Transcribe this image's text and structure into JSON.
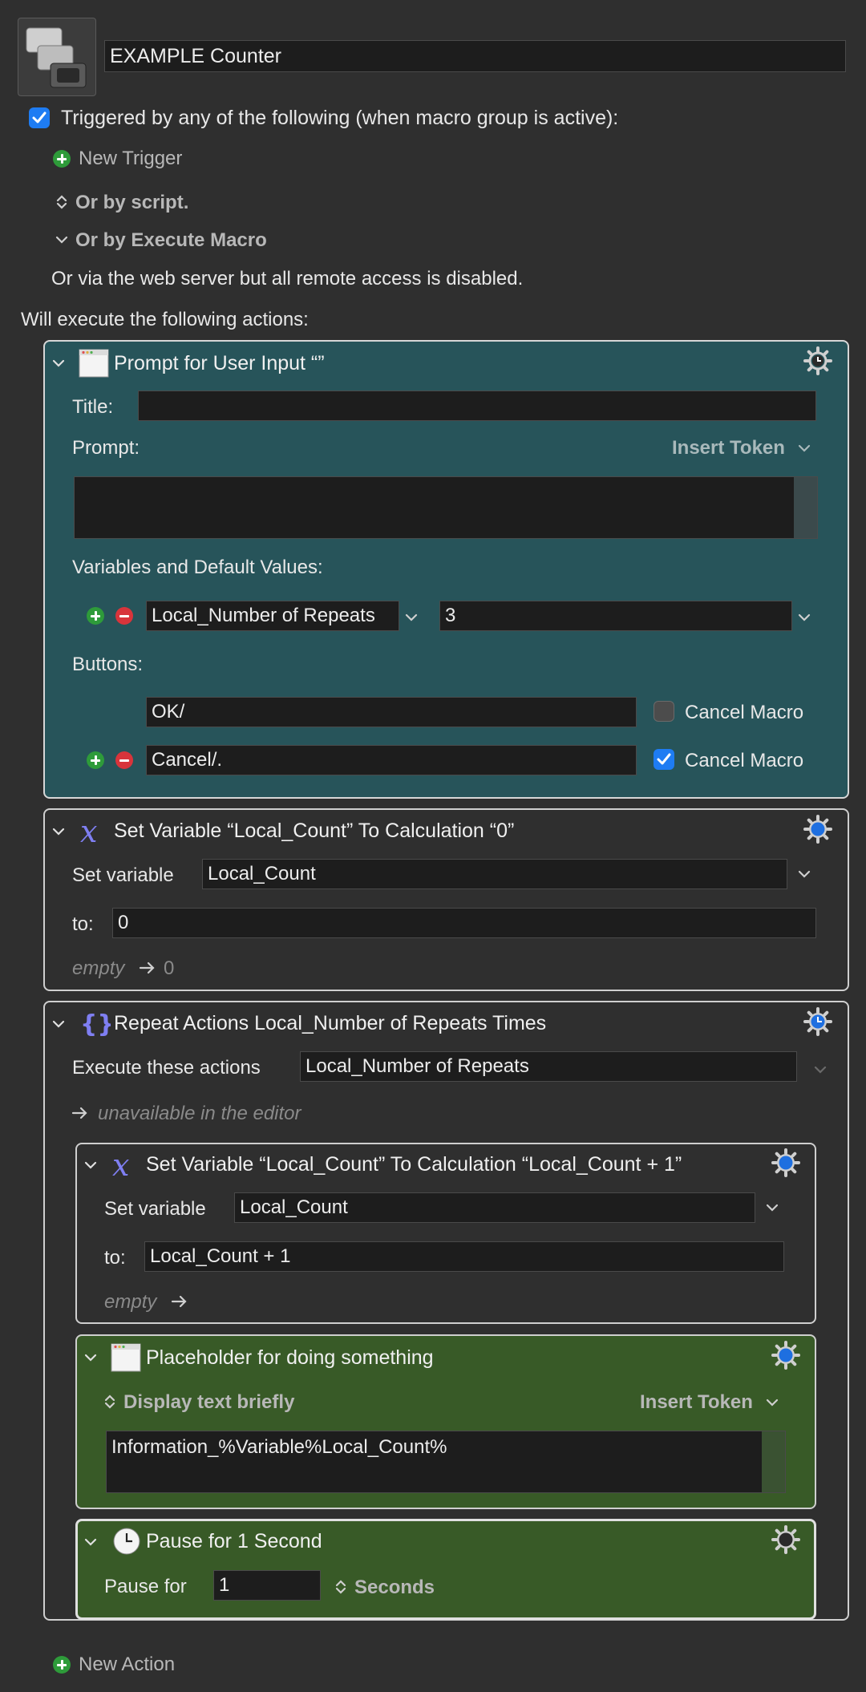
{
  "macro": {
    "name": "EXAMPLE Counter",
    "trigger_checkbox_label": "Triggered by any of the following (when macro group is active):",
    "new_trigger": "New Trigger",
    "or_by_script": "Or by script.",
    "or_by_execute": "Or by Execute Macro",
    "web_server_note": "Or via the web server but all remote access is disabled.",
    "will_execute": "Will execute the following actions:",
    "new_action": "New Action"
  },
  "prompt_action": {
    "title": "Prompt for User Input “”",
    "title_label": "Title:",
    "title_value": "",
    "prompt_label": "Prompt:",
    "insert_token": "Insert Token",
    "prompt_value": "",
    "variables_label": "Variables and Default Values:",
    "variable_name": "Local_Number of Repeats",
    "variable_default": "3",
    "buttons_label": "Buttons:",
    "buttons": [
      {
        "value": "OK/",
        "cancel_label": "Cancel Macro",
        "cancel_checked": false
      },
      {
        "value": "Cancel/.",
        "cancel_label": "Cancel Macro",
        "cancel_checked": true
      }
    ]
  },
  "set_var_action": {
    "title": "Set Variable “Local_Count” To Calculation “0”",
    "set_label": "Set variable",
    "variable": "Local_Count",
    "to_label": "to:",
    "to_value": "0",
    "empty_word": "empty",
    "result": "0"
  },
  "repeat_action": {
    "title": "Repeat Actions Local_Number of Repeats Times",
    "execute_label": "Execute these actions",
    "execute_value": "Local_Number of Repeats",
    "unavailable": "unavailable in the editor"
  },
  "inner_set_var": {
    "title": "Set Variable “Local_Count” To Calculation “Local_Count + 1”",
    "set_label": "Set variable",
    "variable": "Local_Count",
    "to_label": "to:",
    "to_value": "Local_Count + 1",
    "empty_word": "empty"
  },
  "display_action": {
    "title": "Placeholder for doing something",
    "mode": "Display text briefly",
    "insert_token": "Insert Token",
    "text": "Information_%Variable%Local_Count%"
  },
  "pause_action": {
    "title": "Pause for 1 Second",
    "pause_label": "Pause for",
    "value": "1",
    "unit": "Seconds"
  },
  "colors": {
    "teal_card": "#27545a",
    "green_card": "#385a27",
    "checkbox_blue": "#1e7cf3",
    "gear_blue": "#1e6fe0"
  }
}
